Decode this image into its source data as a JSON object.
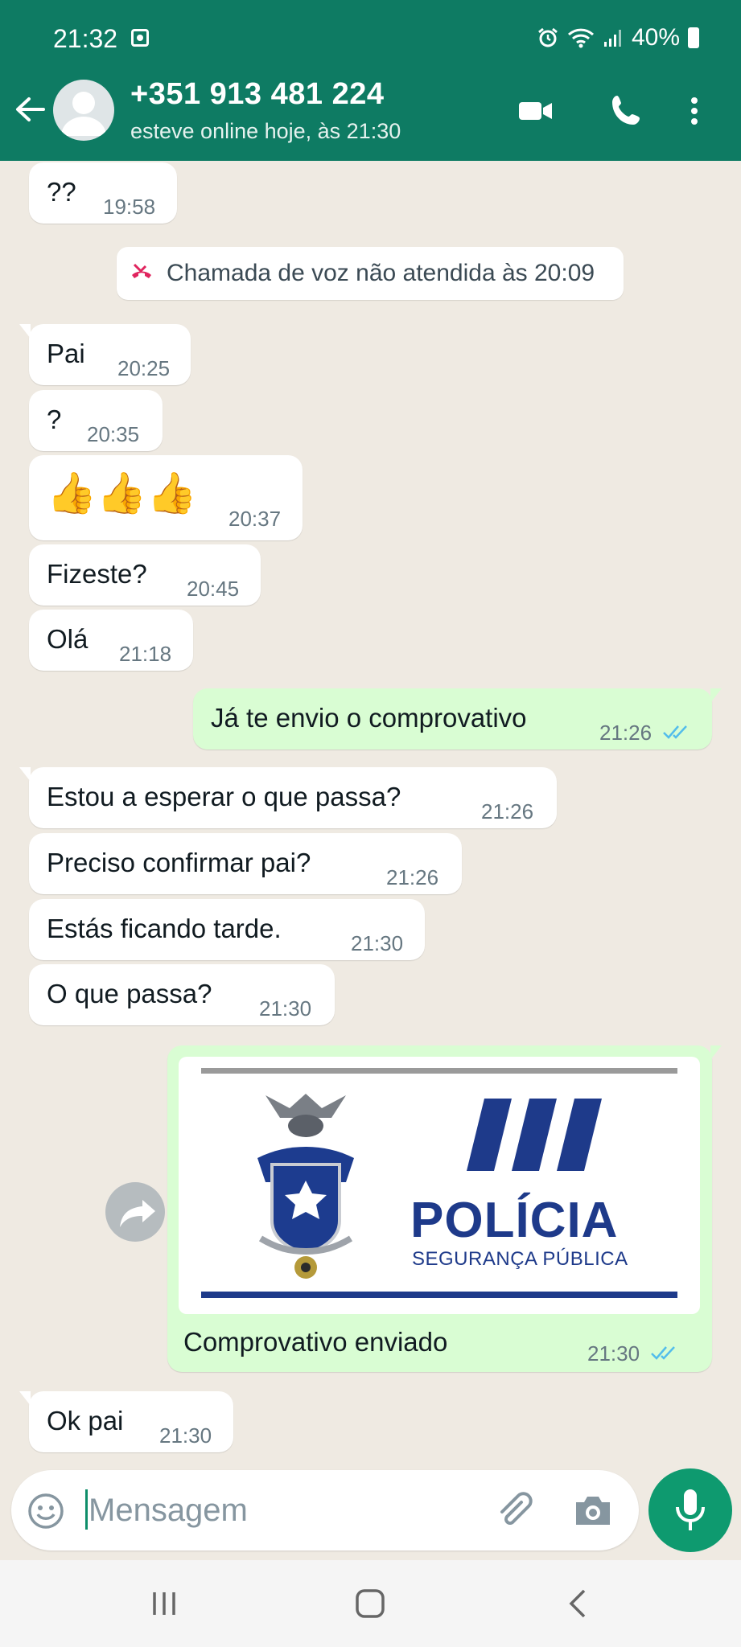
{
  "status_bar": {
    "time": "21:32",
    "battery": "40%"
  },
  "header": {
    "contact_name": "+351 913 481 224",
    "contact_status": "esteve online hoje, às 21:30"
  },
  "messages": [
    {
      "dir": "in",
      "text": "??",
      "time": "19:58"
    },
    {
      "dir": "system",
      "text": "Chamada de voz não atendida às 20:09"
    },
    {
      "dir": "in",
      "text": "Pai",
      "time": "20:25"
    },
    {
      "dir": "in",
      "text": "?",
      "time": "20:35"
    },
    {
      "dir": "in",
      "text": "👍👍👍",
      "time": "20:37"
    },
    {
      "dir": "in",
      "text": "Fizeste?",
      "time": "20:45"
    },
    {
      "dir": "in",
      "text": "Olá",
      "time": "21:18"
    },
    {
      "dir": "out",
      "text": "Já te envio o comprovativo",
      "time": "21:26",
      "read": true
    },
    {
      "dir": "in",
      "text": "Estou a esperar o que passa?",
      "time": "21:26"
    },
    {
      "dir": "in",
      "text": "Preciso confirmar pai?",
      "time": "21:26"
    },
    {
      "dir": "in",
      "text": "Estás ficando tarde.",
      "time": "21:30"
    },
    {
      "dir": "in",
      "text": "O que passa?",
      "time": "21:30"
    },
    {
      "dir": "out",
      "type": "image",
      "caption": "Comprovativo enviado",
      "time": "21:30",
      "read": true,
      "image_text": {
        "title": "POLÍCIA",
        "subtitle": "SEGURANÇA PÚBLICA"
      }
    },
    {
      "dir": "in",
      "text": "Ok pai",
      "time": "21:30"
    }
  ],
  "composer": {
    "placeholder": "Mensagem"
  },
  "colors": {
    "header": "#0e7b63",
    "outgoing": "#d9fdd3",
    "incoming": "#ffffff",
    "read_ticks": "#53bdeb",
    "accent": "#0e9a6f",
    "missed_call": "#e0245e"
  },
  "icons": [
    "back-arrow-icon",
    "video-call-icon",
    "phone-icon",
    "more-options-icon",
    "missed-call-icon",
    "forward-icon",
    "emoji-icon",
    "attach-icon",
    "camera-icon",
    "mic-icon",
    "nav-recents-icon",
    "nav-home-icon",
    "nav-back-icon"
  ]
}
